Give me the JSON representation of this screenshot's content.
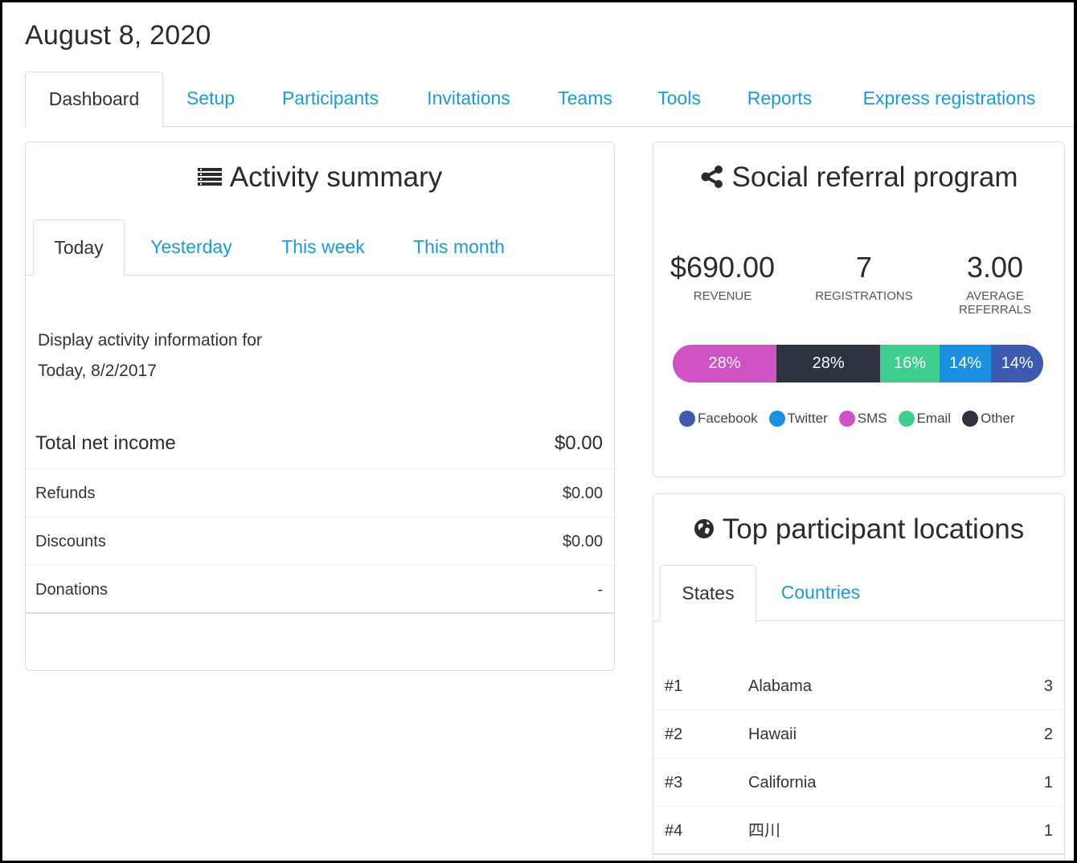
{
  "page": {
    "title": "August 8, 2020"
  },
  "main_tabs": [
    {
      "label": "Dashboard",
      "active": true
    },
    {
      "label": "Setup"
    },
    {
      "label": "Participants"
    },
    {
      "label": "Invitations"
    },
    {
      "label": "Teams"
    },
    {
      "label": "Tools"
    },
    {
      "label": "Reports"
    },
    {
      "label": "Express registrations"
    }
  ],
  "activity": {
    "title": "Activity summary",
    "icon": "list-icon",
    "tabs": [
      {
        "label": "Today",
        "active": true
      },
      {
        "label": "Yesterday"
      },
      {
        "label": "This week"
      },
      {
        "label": "This month"
      }
    ],
    "description_line1": "Display activity information for",
    "description_line2": "Today, 8/2/2017",
    "total": {
      "label": "Total net income",
      "value": "$0.00"
    },
    "rows": [
      {
        "label": "Refunds",
        "value": "$0.00"
      },
      {
        "label": "Discounts",
        "value": "$0.00"
      },
      {
        "label": "Donations",
        "value": "-"
      }
    ]
  },
  "social": {
    "title": "Social referral program",
    "icon": "share-icon",
    "stats": {
      "revenue": {
        "value": "$690.00",
        "label": "REVENUE"
      },
      "registrations": {
        "value": "7",
        "label": "REGISTRATIONS"
      },
      "average": {
        "value": "3.00",
        "label_line1": "AVERAGE",
        "label_line2": "REFERRALS"
      }
    },
    "segments": [
      {
        "label": "28%",
        "percent": 28,
        "color": "#d053c5",
        "channel": "SMS"
      },
      {
        "label": "28%",
        "percent": 28,
        "color": "#2d3440",
        "channel": "Other"
      },
      {
        "label": "16%",
        "percent": 16,
        "color": "#3ecf8e",
        "channel": "Email"
      },
      {
        "label": "14%",
        "percent": 14,
        "color": "#1b8fe0",
        "channel": "Twitter"
      },
      {
        "label": "14%",
        "percent": 14,
        "color": "#3c5bb0",
        "channel": "Facebook"
      }
    ],
    "legend": [
      {
        "label": "Facebook",
        "color": "#3c5bb0"
      },
      {
        "label": "Twitter",
        "color": "#1b8fe0"
      },
      {
        "label": "SMS",
        "color": "#d053c5"
      },
      {
        "label": "Email",
        "color": "#3ecf8e"
      },
      {
        "label": "Other",
        "color": "#2d3440"
      }
    ]
  },
  "locations": {
    "title": "Top participant locations",
    "icon": "globe-icon",
    "tabs": [
      {
        "label": "States",
        "active": true
      },
      {
        "label": "Countries"
      }
    ],
    "rows": [
      {
        "rank": "#1",
        "name": "Alabama",
        "count": "3"
      },
      {
        "rank": "#2",
        "name": "Hawaii",
        "count": "2"
      },
      {
        "rank": "#3",
        "name": "California",
        "count": "1"
      },
      {
        "rank": "#4",
        "name": "四川",
        "count": "1"
      }
    ]
  }
}
